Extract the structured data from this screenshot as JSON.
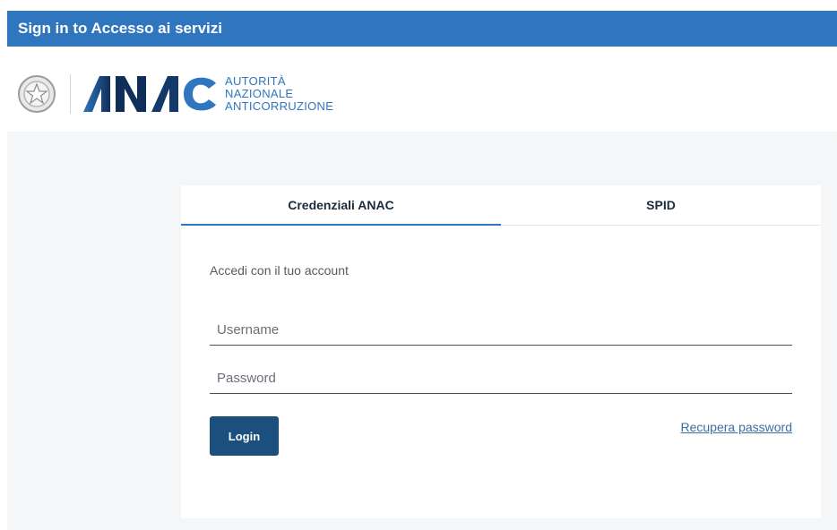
{
  "window": {
    "title": "Sign in to Accesso ai servizi"
  },
  "brand": {
    "logo_text": "ANAC",
    "line1": "AUTORITÀ",
    "line2": "NAZIONALE",
    "line3": "ANTICORRUZIONE",
    "emblem_icon": "italian-republic-emblem-icon",
    "color": "#2f76bf",
    "logo_dark_color": "#0f2f5a"
  },
  "tabs": [
    {
      "label": "Credenziali ANAC",
      "active": true
    },
    {
      "label": "SPID",
      "active": false
    }
  ],
  "form": {
    "subtitle": "Accedi con il tuo account",
    "username_placeholder": "Username",
    "username_value": "",
    "password_placeholder": "Password",
    "password_value": "",
    "login_label": "Login",
    "recover_label": "Recupera password"
  },
  "colors": {
    "accent": "#2f76bf",
    "button": "#1b4f7e",
    "page_bg": "#f5f6f7"
  }
}
